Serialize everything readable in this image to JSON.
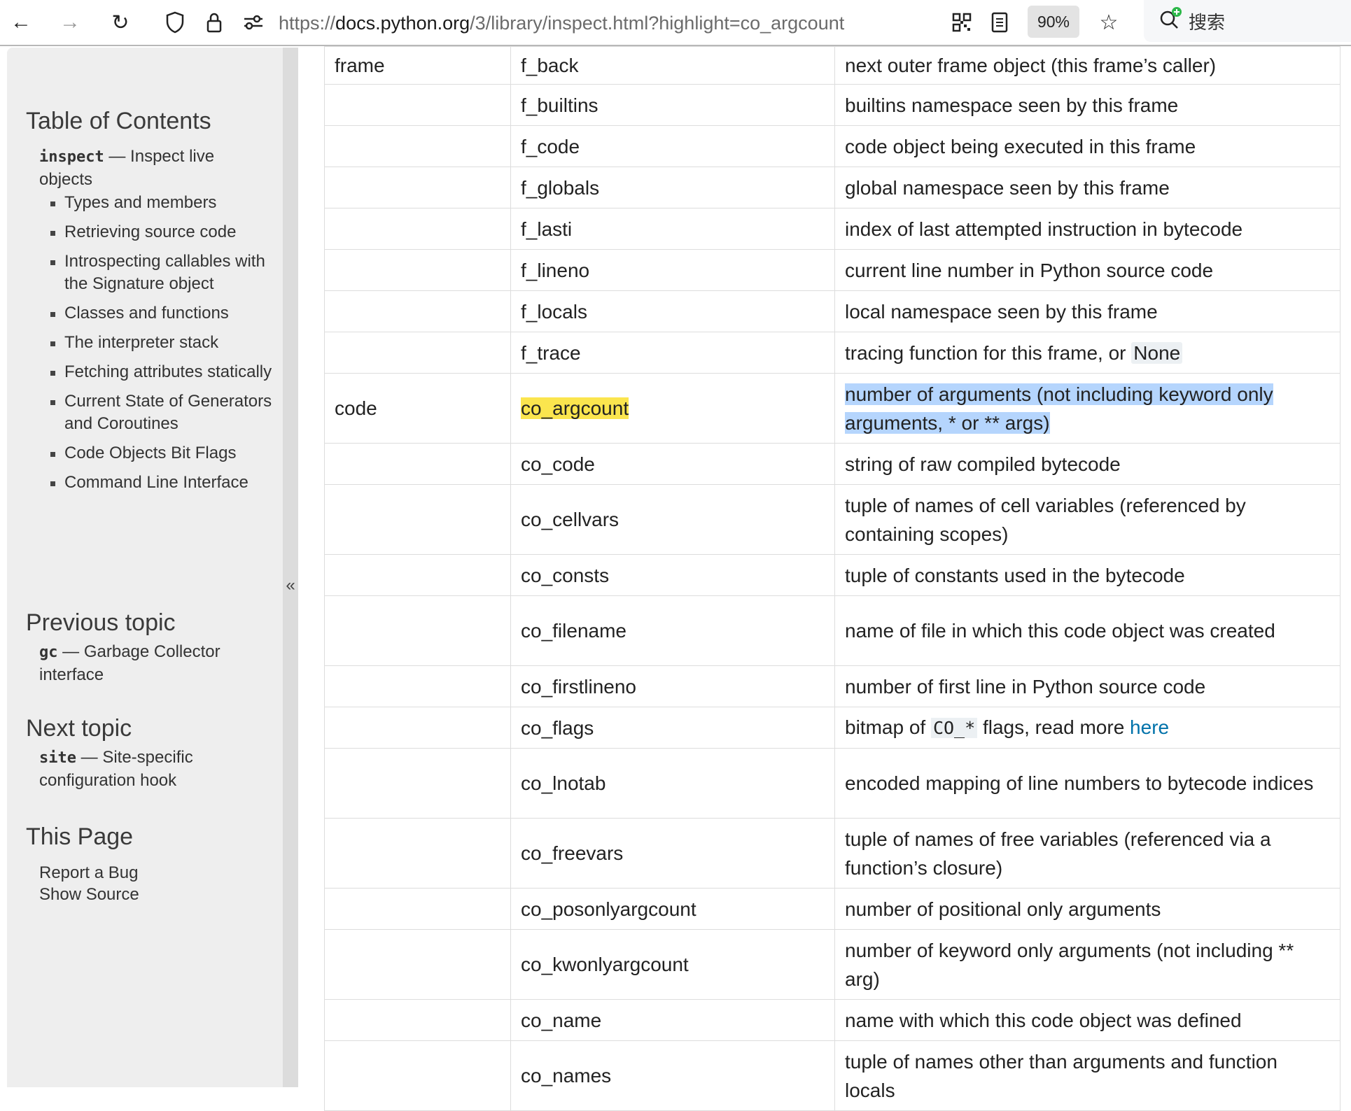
{
  "browser": {
    "url_prefix": "https://",
    "url_domain": "docs.python.org",
    "url_path": "/3/library/inspect.html?highlight=co_argcount",
    "zoom": "90%",
    "search_label": "搜索",
    "icons": [
      "back-icon",
      "forward-icon",
      "reload-icon",
      "shield-icon",
      "lock-icon",
      "permissions-icon",
      "qr-code-icon",
      "reader-view-icon",
      "star-icon",
      "search-icon"
    ]
  },
  "sidebar": {
    "toc_heading": "Table of Contents",
    "module": "inspect",
    "module_desc": " — Inspect live objects",
    "items": [
      "Types and members",
      "Retrieving source code",
      "Introspecting callables with the Signature object",
      "Classes and functions",
      "The interpreter stack",
      "Fetching attributes statically",
      "Current State of Generators and Coroutines",
      "Code Objects Bit Flags",
      "Command Line Interface"
    ],
    "prev_heading": "Previous topic",
    "prev_module": "gc",
    "prev_desc": " — Garbage Collector interface",
    "next_heading": "Next topic",
    "next_module": "site",
    "next_desc": " — Site-specific configuration hook",
    "this_page_heading": "This Page",
    "report_bug": "Report a Bug",
    "show_source": "Show Source",
    "collapse": "«"
  },
  "colors": {
    "highlight": "#fbe54e",
    "selection": "#b5d5fd",
    "link": "#0072aa"
  },
  "table": {
    "rows": [
      {
        "type": "frame",
        "attr": "f_back",
        "desc": [
          {
            "t": "next outer frame object (this frame’s caller)"
          }
        ],
        "h": 50
      },
      {
        "type": "",
        "attr": "f_builtins",
        "desc": [
          {
            "t": "builtins namespace seen by this frame"
          }
        ],
        "h": 59
      },
      {
        "type": "",
        "attr": "f_code",
        "desc": [
          {
            "t": "code object being executed in this frame"
          }
        ],
        "h": 59
      },
      {
        "type": "",
        "attr": "f_globals",
        "desc": [
          {
            "t": "global namespace seen by this frame"
          }
        ],
        "h": 59
      },
      {
        "type": "",
        "attr": "f_lasti",
        "desc": [
          {
            "t": "index of last attempted instruction in bytecode"
          }
        ],
        "h": 59
      },
      {
        "type": "",
        "attr": "f_lineno",
        "desc": [
          {
            "t": "current line number in Python source code"
          }
        ],
        "h": 59
      },
      {
        "type": "",
        "attr": "f_locals",
        "desc": [
          {
            "t": "local namespace seen by this frame"
          }
        ],
        "h": 59
      },
      {
        "type": "",
        "attr": "f_trace",
        "desc": [
          {
            "t": "tracing function for this frame, or "
          },
          {
            "t": "None",
            "s": "lit"
          }
        ],
        "h": 59
      },
      {
        "type": "code",
        "attr": "co_argcount",
        "attr_hl": true,
        "desc": [
          {
            "t": "number of arguments (not including keyword only arguments, * or ** args)",
            "s": "sel"
          }
        ],
        "h": 100
      },
      {
        "type": "",
        "attr": "co_code",
        "desc": [
          {
            "t": "string of raw compiled bytecode"
          }
        ],
        "h": 59
      },
      {
        "type": "",
        "attr": "co_cellvars",
        "desc": [
          {
            "t": "tuple of names of cell variables (referenced by containing scopes)"
          }
        ],
        "h": 100
      },
      {
        "type": "",
        "attr": "co_consts",
        "desc": [
          {
            "t": "tuple of constants used in the bytecode"
          }
        ],
        "h": 59
      },
      {
        "type": "",
        "attr": "co_filename",
        "desc": [
          {
            "t": "name of file in which this code object was created"
          }
        ],
        "h": 100
      },
      {
        "type": "",
        "attr": "co_firstlineno",
        "desc": [
          {
            "t": "number of first line in Python source code"
          }
        ],
        "h": 59
      },
      {
        "type": "",
        "attr": "co_flags",
        "desc": [
          {
            "t": "bitmap of "
          },
          {
            "t": "CO_*",
            "s": "mono"
          },
          {
            "t": " flags, read more "
          },
          {
            "t": "here",
            "s": "link"
          }
        ],
        "h": 59
      },
      {
        "type": "",
        "attr": "co_lnotab",
        "desc": [
          {
            "t": "encoded mapping of line numbers to bytecode indices"
          }
        ],
        "h": 100
      },
      {
        "type": "",
        "attr": "co_freevars",
        "desc": [
          {
            "t": "tuple of names of free variables (referenced via a function’s closure)"
          }
        ],
        "h": 100
      },
      {
        "type": "",
        "attr": "co_posonlyargcount",
        "desc": [
          {
            "t": "number of positional only arguments"
          }
        ],
        "h": 59
      },
      {
        "type": "",
        "attr": "co_kwonlyargcount",
        "desc": [
          {
            "t": "number of keyword only arguments (not including ** arg)"
          }
        ],
        "h": 100
      },
      {
        "type": "",
        "attr": "co_name",
        "desc": [
          {
            "t": "name with which this code object was defined"
          }
        ],
        "h": 59
      },
      {
        "type": "",
        "attr": "co_names",
        "desc": [
          {
            "t": "tuple of names other than arguments and function locals"
          }
        ],
        "h": 100
      }
    ]
  }
}
